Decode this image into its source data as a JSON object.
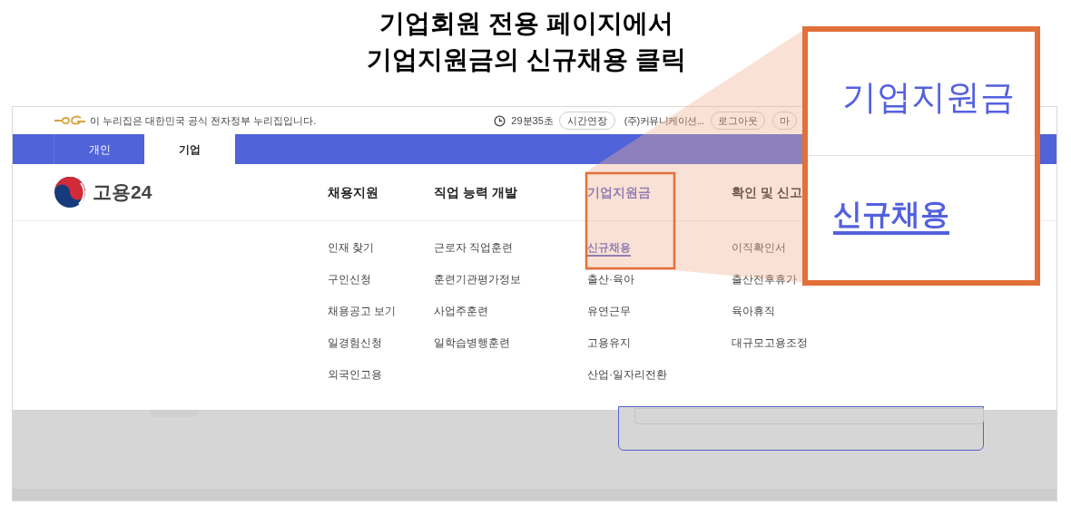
{
  "caption": {
    "lines": [
      "기업회원 전용 페이지에서",
      "기업지원금의 신규채용 클릭"
    ]
  },
  "utility_bar": {
    "notice": "이 누리집은 대한민국 공식 전자정부 누리집입니다.",
    "timer": "29분35초",
    "extend_button": "시간연장",
    "user": "(주)커뮤니케이션...",
    "buttons": [
      "로그아웃",
      "마"
    ]
  },
  "member_tabs": [
    {
      "label": "개인",
      "selected": false
    },
    {
      "label": "기업",
      "selected": true
    }
  ],
  "logo": "고용24",
  "nav": [
    {
      "label": "채용지원",
      "selected": false,
      "items": [
        {
          "label": "인재 찾기",
          "selected": false
        },
        {
          "label": "구인신청",
          "selected": false
        },
        {
          "label": "채용공고 보기",
          "selected": false
        },
        {
          "label": "일경험신청",
          "selected": false
        },
        {
          "label": "외국인고용",
          "selected": false
        }
      ]
    },
    {
      "label": "직업 능력 개발",
      "selected": false,
      "items": [
        {
          "label": "근로자 직업훈련",
          "selected": false
        },
        {
          "label": "훈련기관평가정보",
          "selected": false
        },
        {
          "label": "사업주훈련",
          "selected": false
        },
        {
          "label": "일학습병행훈련",
          "selected": false
        }
      ]
    },
    {
      "label": "기업지원금",
      "selected": true,
      "items": [
        {
          "label": "신규채용",
          "selected": true
        },
        {
          "label": "출산·육아",
          "selected": false
        },
        {
          "label": "유연근무",
          "selected": false
        },
        {
          "label": "고용유지",
          "selected": false
        },
        {
          "label": "산업·일자리전환",
          "selected": false
        }
      ]
    },
    {
      "label": "확인 및 신고",
      "selected": false,
      "items": [
        {
          "label": "이직확인서",
          "selected": false
        },
        {
          "label": "출산전후휴가",
          "selected": false
        },
        {
          "label": "육아휴직",
          "selected": false
        },
        {
          "label": "대규모고용조정",
          "selected": false
        }
      ]
    }
  ],
  "callout": {
    "title": "기업지원금",
    "link": "신규채용"
  }
}
